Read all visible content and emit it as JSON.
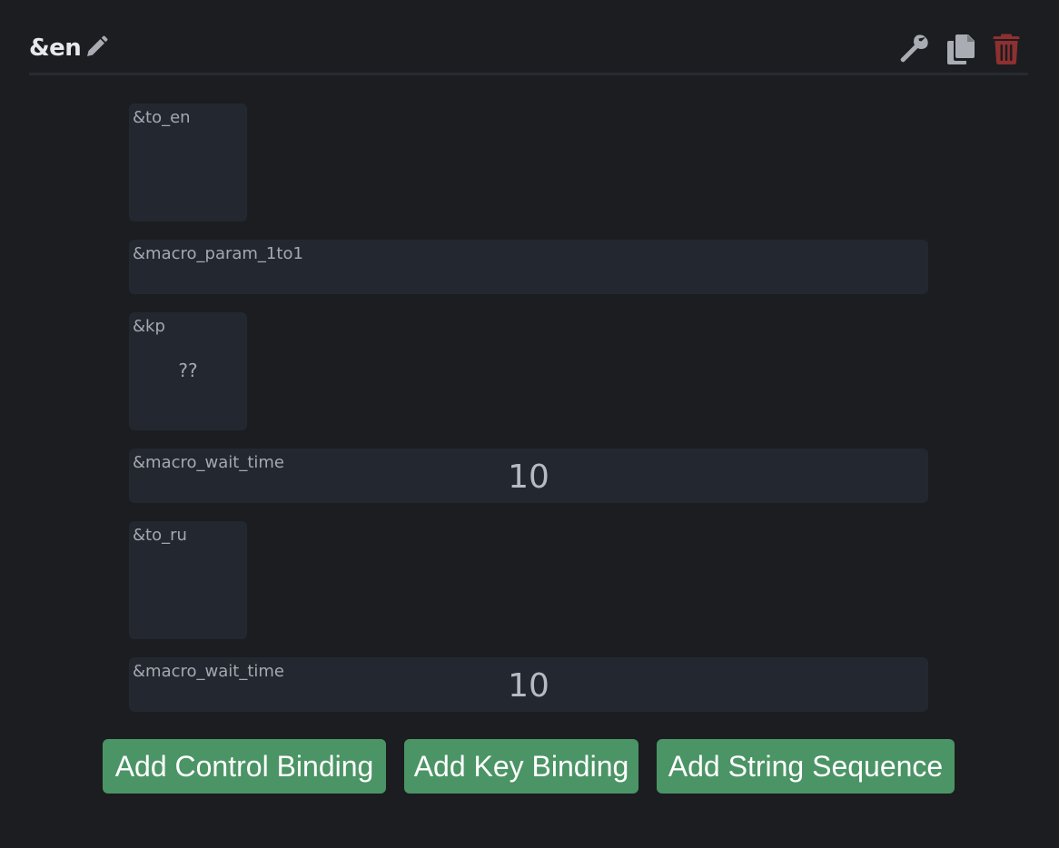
{
  "header": {
    "macro_name": "&en",
    "icons": {
      "edit": "pencil-icon",
      "settings": "wrench-icon",
      "duplicate": "copy-icon",
      "delete": "trash-icon"
    },
    "colors": {
      "delete_icon": "#8f3030",
      "neutral_icon": "#a9adb3"
    }
  },
  "bindings": [
    {
      "label": "&to_en"
    },
    {
      "label": "&macro_param_1to1"
    },
    {
      "label": "&kp",
      "param": "??"
    },
    {
      "label": "&macro_wait_time",
      "value": "10"
    },
    {
      "label": "&to_ru"
    },
    {
      "label": "&macro_wait_time",
      "value": "10"
    }
  ],
  "actions": {
    "add_control_binding": "Add Control Binding",
    "add_key_binding": "Add Key Binding",
    "add_string_sequence": "Add String Sequence",
    "button_color": "#4b9465"
  }
}
